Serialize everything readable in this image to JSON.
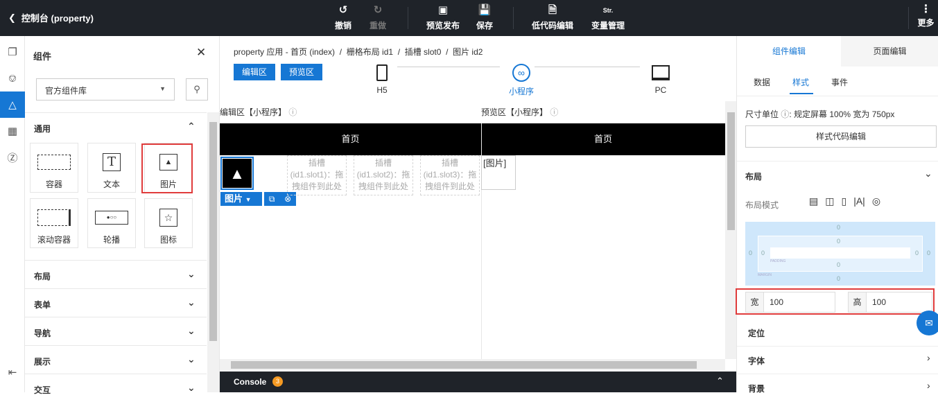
{
  "topbar": {
    "back_label": "控制台 (property)",
    "undo": "撤销",
    "redo": "重做",
    "preview_publish": "预览发布",
    "save": "保存",
    "lowcode_edit": "低代码编辑",
    "var_manage": "变量管理",
    "var_icon_text": "Str.",
    "more": "更多"
  },
  "components_panel": {
    "title": "组件",
    "library_select": "官方组件库",
    "sections_open": "通用",
    "general_items": [
      {
        "label": "容器"
      },
      {
        "label": "文本"
      },
      {
        "label": "图片"
      },
      {
        "label": "滚动容器"
      },
      {
        "label": "轮播"
      },
      {
        "label": "图标"
      }
    ],
    "sections": [
      "布局",
      "表单",
      "导航",
      "展示",
      "交互"
    ]
  },
  "center": {
    "breadcrumb": "property 应用 - 首页 (index)  /  栅格布局 id1  /  插槽 slot0  /  图片 id2",
    "edit_btn": "编辑区",
    "preview_btn": "预览区",
    "devices": [
      {
        "label": "H5"
      },
      {
        "label": "小程序"
      },
      {
        "label": "PC"
      }
    ],
    "edit_label": "编辑区【小程序】",
    "preview_label": "预览区【小程序】",
    "page_header": "首页",
    "image_toolbar_label": "图片",
    "slots": [
      "插槽\n(id1.slot1)：拖拽组件到此处",
      "插槽\n(id1.slot2)：拖拽组件到此处",
      "插槽\n(id1.slot3)：拖拽组件到此处"
    ],
    "broken_image_alt": "[图片]",
    "console_label": "Console",
    "console_badge": "3"
  },
  "right_panel": {
    "tab_component": "组件编辑",
    "tab_page": "页面编辑",
    "subtabs": [
      "数据",
      "样式",
      "事件"
    ],
    "unit_label": "尺寸单位",
    "unit_value": "规定屏幕 100% 宽为 750px",
    "style_code_btn": "样式代码编辑",
    "layout_section": "布局",
    "layout_mode_label": "布局模式",
    "box_values": [
      "0",
      "0",
      "0",
      "0",
      "0",
      "0",
      "0",
      "0"
    ],
    "padding_label": "PADDING",
    "margin_label": "MARGIN",
    "width_label": "宽",
    "width_value": "100",
    "height_label": "高",
    "height_value": "100",
    "position_section": "定位",
    "font_section": "字体",
    "bg_section": "背景"
  },
  "colors": {
    "accent": "#1677d4",
    "topbar": "#1f2329",
    "highlight": "#e03b3b"
  }
}
